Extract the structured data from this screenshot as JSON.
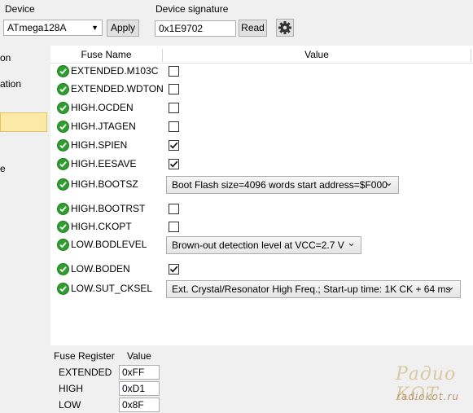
{
  "toolbar": {
    "device_label": "Device",
    "device_value": "ATmega128A",
    "apply_label": "Apply",
    "signature_label": "Device signature",
    "signature_value": "0x1E9702",
    "read_label": "Read",
    "settings_icon": "gear-icon"
  },
  "nav": {
    "items": [
      "on",
      "ation",
      "e"
    ]
  },
  "grid": {
    "col_name": "Fuse Name",
    "col_value": "Value",
    "rows": [
      {
        "name": "EXTENDED.M103C",
        "type": "checkbox",
        "checked": false
      },
      {
        "name": "EXTENDED.WDTON",
        "type": "checkbox",
        "checked": false
      },
      {
        "name": "HIGH.OCDEN",
        "type": "checkbox",
        "checked": false
      },
      {
        "name": "HIGH.JTAGEN",
        "type": "checkbox",
        "checked": false
      },
      {
        "name": "HIGH.SPIEN",
        "type": "checkbox",
        "checked": true
      },
      {
        "name": "HIGH.EESAVE",
        "type": "checkbox",
        "checked": true
      },
      {
        "name": "HIGH.BOOTSZ",
        "type": "select",
        "value": "Boot Flash size=4096 words start address=$F000"
      },
      {
        "name": "HIGH.BOOTRST",
        "type": "checkbox",
        "checked": false
      },
      {
        "name": "HIGH.CKOPT",
        "type": "checkbox",
        "checked": false
      },
      {
        "name": "LOW.BODLEVEL",
        "type": "select",
        "value": "Brown-out detection level at VCC=2.7 V"
      },
      {
        "name": "LOW.BODEN",
        "type": "checkbox",
        "checked": true
      },
      {
        "name": "LOW.SUT_CKSEL",
        "type": "select",
        "value": "Ext. Crystal/Resonator High Freq.; Start-up time: 1K CK + 64 ms"
      }
    ]
  },
  "register": {
    "col_name": "Fuse Register",
    "col_value": "Value",
    "rows": [
      {
        "name": "EXTENDED",
        "value": "0xFF"
      },
      {
        "name": "HIGH",
        "value": "0xD1"
      },
      {
        "name": "LOW",
        "value": "0x8F"
      }
    ]
  },
  "watermark": {
    "logo": "Радио КОТ",
    "url": "radiokot.ru"
  },
  "colors": {
    "ok_green": "#2f9e2f",
    "nav_selected": "#fce9a8"
  }
}
